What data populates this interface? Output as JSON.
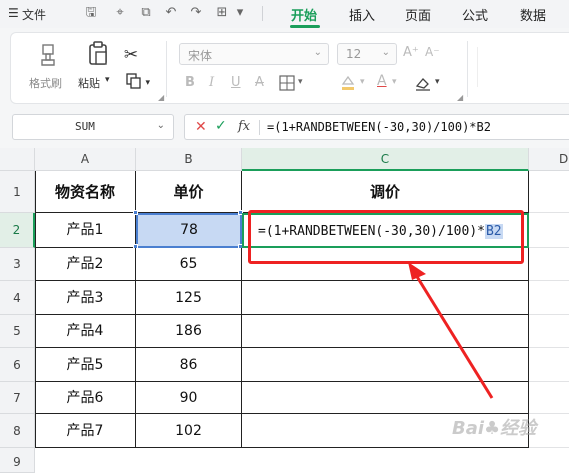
{
  "menu": {
    "file_label": "文件",
    "tabs": [
      {
        "label": "开始",
        "active": true
      },
      {
        "label": "插入",
        "active": false
      },
      {
        "label": "页面",
        "active": false
      },
      {
        "label": "公式",
        "active": false
      },
      {
        "label": "数据",
        "active": false
      }
    ]
  },
  "ribbon": {
    "format_painter_label": "格式刷",
    "paste_label": "粘贴",
    "font_name": "宋体",
    "font_size": "12"
  },
  "formula_bar": {
    "name_box": "SUM",
    "formula": "=(1+RANDBETWEEN(-30,30)/100)*B2"
  },
  "grid": {
    "columns": [
      "A",
      "B",
      "C",
      "D"
    ],
    "rows": [
      "1",
      "2",
      "3",
      "4",
      "5",
      "6",
      "7",
      "8",
      "9"
    ],
    "headers": {
      "A": "物资名称",
      "B": "单价",
      "C": "调价"
    },
    "data": [
      {
        "name": "产品1",
        "price": "78"
      },
      {
        "name": "产品2",
        "price": "65"
      },
      {
        "name": "产品3",
        "price": "125"
      },
      {
        "name": "产品4",
        "price": "186"
      },
      {
        "name": "产品5",
        "price": "86"
      },
      {
        "name": "产品6",
        "price": "90"
      },
      {
        "name": "产品7",
        "price": "102"
      }
    ],
    "editing_cell": {
      "formula_prefix": "=(1+RANDBETWEEN(-30,30)/100)*",
      "formula_ref": "B2"
    }
  },
  "colors": {
    "accent": "#1a9e5a",
    "annotation": "#e22222",
    "selection": "#c7d9f3"
  }
}
